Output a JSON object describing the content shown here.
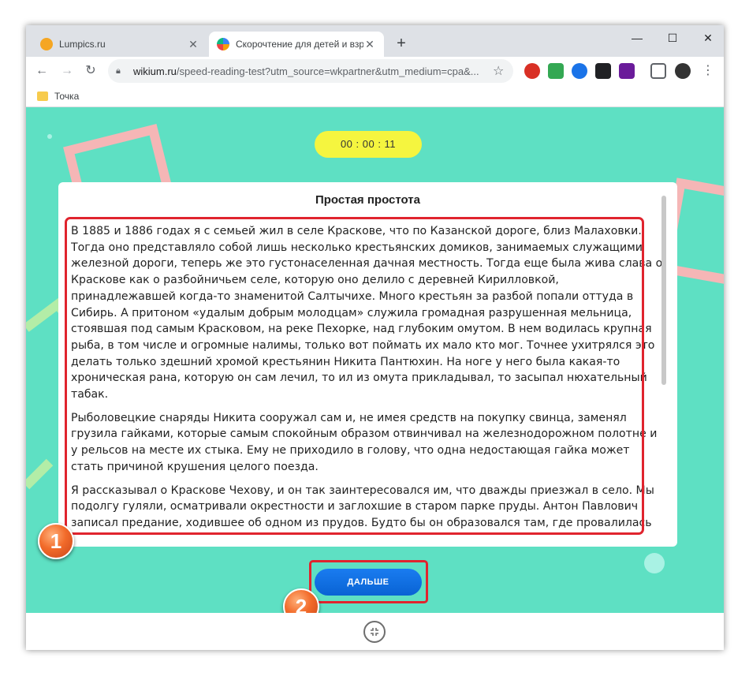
{
  "browser": {
    "tabs": [
      {
        "title": "Lumpics.ru",
        "favicon_color": "#f5a623",
        "active": false
      },
      {
        "title": "Скорочтение для детей и взрос",
        "favicon_color": "#3b82f6",
        "active": true
      }
    ],
    "new_tab": "+",
    "window_controls": {
      "minimize": "—",
      "maximize": "☐",
      "close": "✕"
    },
    "nav": {
      "back": "←",
      "forward": "→",
      "reload": "↻"
    },
    "url_host": "wikium.ru",
    "url_path": "/speed-reading-test?utm_source=wkpartner&utm_medium=cpa&...",
    "bookmark": "Точка"
  },
  "page": {
    "background": "#5ee0c3",
    "timer": "00 : 00 : 11",
    "card_title": "Простая простота",
    "paragraphs": [
      "В 1885 и 1886 годах я с семьей жил в селе Краскове, что по Казанской дороге, близ Малаховки. Тогда оно представляло собой лишь несколько крестьянских домиков, занимаемых служащими железной дороги, теперь же это густонаселенная дачная местность. Тогда еще была жива слава о Краскове как о разбойничьем селе, которую оно делило с деревней Кирилловкой, принадлежавшей когда-то знаменитой Салтычихе. Много крестьян за разбой попали оттуда в Сибирь. А притоном «удалым добрым молодцам» служила громадная разрушенная мельница, стоявшая под самым Красковом, на реке Пехорке, над глубоким омутом. В нем водилась крупная рыба, в том числе и огромные налимы, только вот поймать их мало кто мог. Точнее ухитрялся это делать только здешний хромой крестьянин Никита Пантюхин. На ноге у него была какая-то хроническая рана, которую он сам лечил, то ил из омута прикладывал, то засыпал нюхательный табак.",
      "Рыболовецкие снаряды Никита сооружал сам и, не имея средств на покупку свинца, заменял грузила гайками, которые самым спокойным образом отвинчивал на железнодорожном полотне и у рельсов на месте их стыка. Ему не приходило в голову, что одна недостающая гайка может стать причиной крушения целого поезда.",
      "Я рассказывал о Краскове Чехову, и он так заинтересовался им, что дважды приезжал в село. Мы подолгу гуляли, осматривали окрестности и заглохшие в старом парке пруды. Антон Павлович записал предание, ходившее об одном из прудов. Будто бы он образовался там, где провалилась"
    ],
    "next_button": "ДАЛЬШЕ",
    "annotations": {
      "badge_1": "1",
      "badge_2": "2",
      "highlight_color": "#e0242e"
    }
  }
}
